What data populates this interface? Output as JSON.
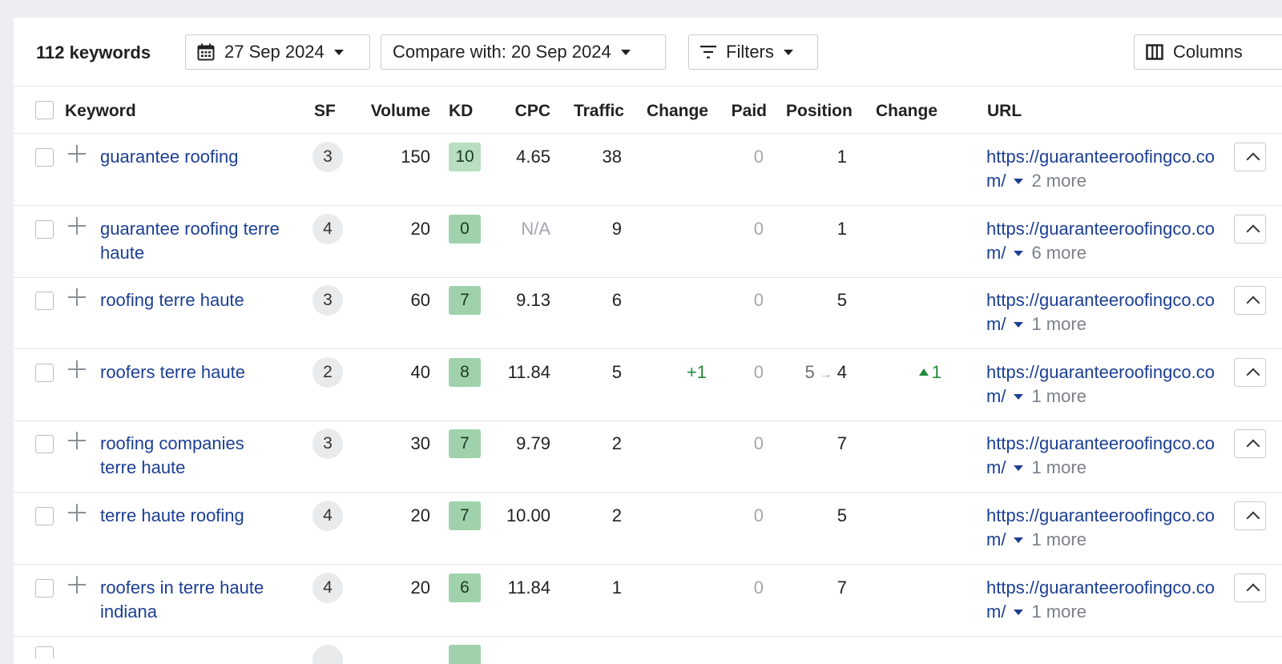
{
  "toolbar": {
    "keyword_count": "112 keywords",
    "date": "27 Sep 2024",
    "compare": "Compare with: 20 Sep 2024",
    "filters": "Filters",
    "columns": "Columns"
  },
  "headers": {
    "keyword": "Keyword",
    "sf": "SF",
    "volume": "Volume",
    "kd": "KD",
    "cpc": "CPC",
    "traffic": "Traffic",
    "change": "Change",
    "paid": "Paid",
    "position": "Position",
    "position_change": "Change",
    "url": "URL"
  },
  "colors": {
    "link": "#1c3f94",
    "positive": "#23893a",
    "kd_light": "#b8dfc0",
    "kd_mid": "#9fd2ac"
  },
  "rows": [
    {
      "keyword": "guarantee roofing",
      "sf": "3",
      "volume": "150",
      "kd": "10",
      "kd_color": "#b8dfc0",
      "cpc": "4.65",
      "cpc_na": false,
      "traffic": "38",
      "change": "",
      "paid": "0",
      "pos_old": "",
      "pos": "1",
      "pos_change": "",
      "url": "https://guaranteeroofingco.com/",
      "more": "2 more"
    },
    {
      "keyword": "guarantee roofing terre haute",
      "sf": "4",
      "volume": "20",
      "kd": "0",
      "kd_color": "#9fd2ac",
      "cpc": "N/A",
      "cpc_na": true,
      "traffic": "9",
      "change": "",
      "paid": "0",
      "pos_old": "",
      "pos": "1",
      "pos_change": "",
      "url": "https://guaranteeroofingco.com/",
      "more": "6 more"
    },
    {
      "keyword": "roofing terre haute",
      "sf": "3",
      "volume": "60",
      "kd": "7",
      "kd_color": "#9fd2ac",
      "cpc": "9.13",
      "cpc_na": false,
      "traffic": "6",
      "change": "",
      "paid": "0",
      "pos_old": "",
      "pos": "5",
      "pos_change": "",
      "url": "https://guaranteeroofingco.com/",
      "more": "1 more"
    },
    {
      "keyword": "roofers terre haute",
      "sf": "2",
      "volume": "40",
      "kd": "8",
      "kd_color": "#9fd2ac",
      "cpc": "11.84",
      "cpc_na": false,
      "traffic": "5",
      "change": "+1",
      "paid": "0",
      "pos_old": "5",
      "pos": "4",
      "pos_change": "1",
      "url": "https://guaranteeroofingco.com/",
      "more": "1 more"
    },
    {
      "keyword": "roofing companies terre haute",
      "sf": "3",
      "volume": "30",
      "kd": "7",
      "kd_color": "#9fd2ac",
      "cpc": "9.79",
      "cpc_na": false,
      "traffic": "2",
      "change": "",
      "paid": "0",
      "pos_old": "",
      "pos": "7",
      "pos_change": "",
      "url": "https://guaranteeroofingco.com/",
      "more": "1 more"
    },
    {
      "keyword": "terre haute roofing",
      "sf": "4",
      "volume": "20",
      "kd": "7",
      "kd_color": "#9fd2ac",
      "cpc": "10.00",
      "cpc_na": false,
      "traffic": "2",
      "change": "",
      "paid": "0",
      "pos_old": "",
      "pos": "5",
      "pos_change": "",
      "url": "https://guaranteeroofingco.com/",
      "more": "1 more"
    },
    {
      "keyword": "roofers in terre haute indiana",
      "sf": "4",
      "volume": "20",
      "kd": "6",
      "kd_color": "#9fd2ac",
      "cpc": "11.84",
      "cpc_na": false,
      "traffic": "1",
      "change": "",
      "paid": "0",
      "pos_old": "",
      "pos": "7",
      "pos_change": "",
      "url": "https://guaranteeroofingco.com/",
      "more": "1 more"
    }
  ]
}
